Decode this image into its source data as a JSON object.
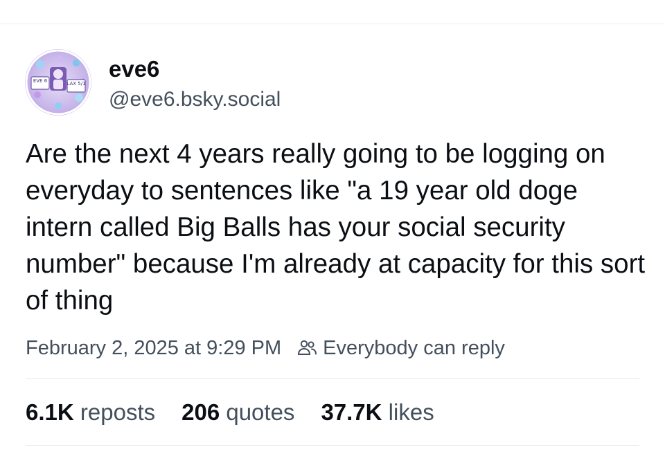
{
  "author": {
    "display_name": "eve6",
    "handle": "@eve6.bsky.social",
    "avatar_text_left": "EVE 6",
    "avatar_text_right": "LAX 5/1"
  },
  "post": {
    "text": "Are the next 4 years really going to be logging on everyday to sentences like \"a 19 year old doge intern called Big Balls has your social security number\" because I'm already at capacity for this sort of thing"
  },
  "meta": {
    "timestamp": "February 2, 2025 at 9:29 PM",
    "reply_setting": "Everybody can reply",
    "reply_icon": "people-icon"
  },
  "stats": {
    "reposts_count": "6.1K",
    "reposts_label": "reposts",
    "quotes_count": "206",
    "quotes_label": "quotes",
    "likes_count": "37.7K",
    "likes_label": "likes"
  },
  "colors": {
    "text_primary": "#0b0f14",
    "text_secondary": "#434f5c",
    "divider": "#e3e6ea"
  }
}
